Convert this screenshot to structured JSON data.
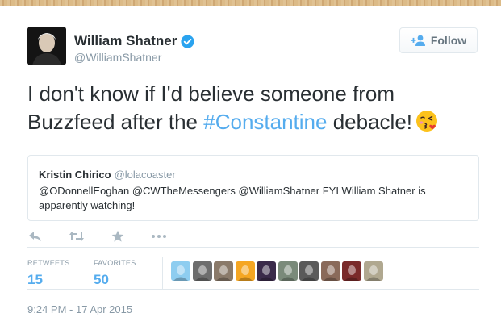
{
  "tweet": {
    "author_name": "William Shatner",
    "author_handle": "@WilliamShatner",
    "follow_label": "Follow",
    "text_part1": "I don't know if I'd believe someone from Buzzfeed after the ",
    "hashtag": "#Constantine",
    "text_part2": " debacle!",
    "emoji": "kissing-face-icon"
  },
  "quoted": {
    "name": "Kristin Chirico",
    "handle": "@lolacoaster",
    "text": "@ODonnellEoghan @CWTheMessengers  @WilliamShatner FYI William Shatner is apparently watching!"
  },
  "actions": [
    "reply-icon",
    "retweet-icon",
    "favorite-icon",
    "more-icon"
  ],
  "stats": {
    "retweets_label": "RETWEETS",
    "retweets": "15",
    "favorites_label": "FAVORITES",
    "favorites": "50"
  },
  "favoriters": [
    {
      "name": "favoriter-avatar-1",
      "color": "#8ecdf0"
    },
    {
      "name": "favoriter-avatar-2",
      "color": "#6d6d6d"
    },
    {
      "name": "favoriter-avatar-3",
      "color": "#8a7a6a"
    },
    {
      "name": "favoriter-avatar-4",
      "color": "#f5a623"
    },
    {
      "name": "favoriter-avatar-5",
      "color": "#3a2a4a"
    },
    {
      "name": "favoriter-avatar-6",
      "color": "#7a8a7a"
    },
    {
      "name": "favoriter-avatar-7",
      "color": "#5a5a5a"
    },
    {
      "name": "favoriter-avatar-8",
      "color": "#8a6a5a"
    },
    {
      "name": "favoriter-avatar-9",
      "color": "#7a2a2a"
    },
    {
      "name": "favoriter-avatar-10",
      "color": "#b0a890"
    }
  ],
  "timestamp": "9:24 PM - 17 Apr 2015",
  "colors": {
    "accent": "#55acee",
    "text": "#292f33",
    "muted": "#8899a6",
    "verified": "#2aa3ef"
  }
}
